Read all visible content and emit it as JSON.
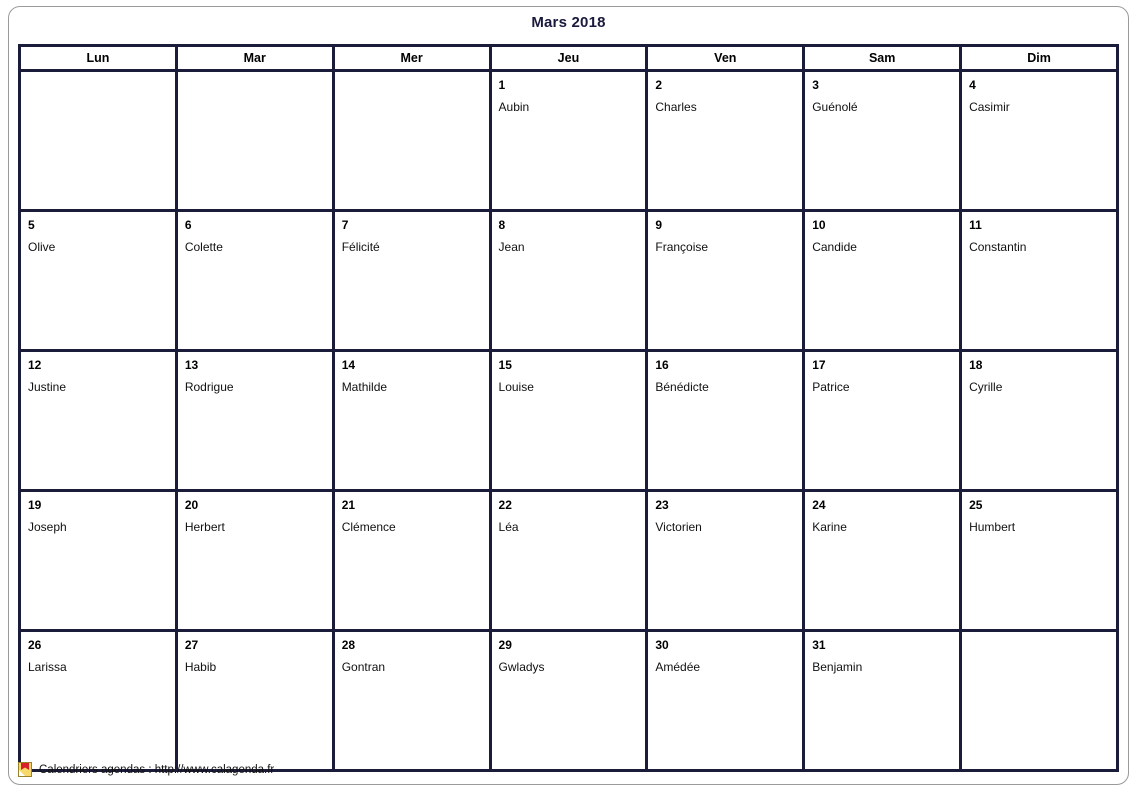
{
  "document": {
    "title": "Mars 2018"
  },
  "calendar": {
    "weekday_headers": [
      "Lun",
      "Mar",
      "Mer",
      "Jeu",
      "Ven",
      "Sam",
      "Dim"
    ],
    "weeks": [
      [
        {
          "day": "",
          "saint": ""
        },
        {
          "day": "",
          "saint": ""
        },
        {
          "day": "",
          "saint": ""
        },
        {
          "day": "1",
          "saint": "Aubin"
        },
        {
          "day": "2",
          "saint": "Charles"
        },
        {
          "day": "3",
          "saint": "Guénolé"
        },
        {
          "day": "4",
          "saint": "Casimir"
        }
      ],
      [
        {
          "day": "5",
          "saint": "Olive"
        },
        {
          "day": "6",
          "saint": "Colette"
        },
        {
          "day": "7",
          "saint": "Félicité"
        },
        {
          "day": "8",
          "saint": "Jean"
        },
        {
          "day": "9",
          "saint": "Françoise"
        },
        {
          "day": "10",
          "saint": "Candide"
        },
        {
          "day": "11",
          "saint": "Constantin"
        }
      ],
      [
        {
          "day": "12",
          "saint": "Justine"
        },
        {
          "day": "13",
          "saint": "Rodrigue"
        },
        {
          "day": "14",
          "saint": "Mathilde"
        },
        {
          "day": "15",
          "saint": "Louise"
        },
        {
          "day": "16",
          "saint": "Bénédicte"
        },
        {
          "day": "17",
          "saint": "Patrice"
        },
        {
          "day": "18",
          "saint": "Cyrille"
        }
      ],
      [
        {
          "day": "19",
          "saint": "Joseph"
        },
        {
          "day": "20",
          "saint": "Herbert"
        },
        {
          "day": "21",
          "saint": "Clémence"
        },
        {
          "day": "22",
          "saint": "Léa"
        },
        {
          "day": "23",
          "saint": "Victorien"
        },
        {
          "day": "24",
          "saint": "Karine"
        },
        {
          "day": "25",
          "saint": "Humbert"
        }
      ],
      [
        {
          "day": "26",
          "saint": "Larissa"
        },
        {
          "day": "27",
          "saint": "Habib"
        },
        {
          "day": "28",
          "saint": "Gontran"
        },
        {
          "day": "29",
          "saint": "Gwladys"
        },
        {
          "day": "30",
          "saint": "Amédée"
        },
        {
          "day": "31",
          "saint": "Benjamin"
        },
        {
          "day": "",
          "saint": ""
        }
      ]
    ]
  },
  "footer": {
    "icon": "bookmark-flag-icon",
    "text": "Calendriers agendas : http://www.calagenda.fr"
  },
  "colors": {
    "grid_border": "#1b1b3a",
    "title_text": "#1a1a3d",
    "outer_frame": "#9a9a9a",
    "cell_background": "#ffffff",
    "icon_yellow": "#f2c230",
    "icon_red": "#d8202a"
  }
}
